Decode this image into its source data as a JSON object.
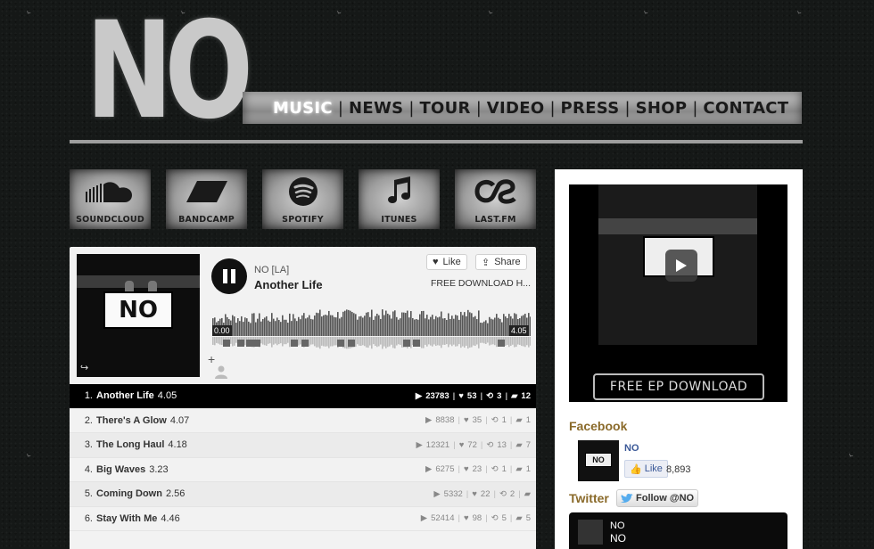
{
  "logo": {
    "text": "NO"
  },
  "nav": {
    "items": [
      {
        "label": "MUSIC",
        "active": true
      },
      {
        "label": "NEWS",
        "active": false
      },
      {
        "label": "TOUR",
        "active": false
      },
      {
        "label": "VIDEO",
        "active": false
      },
      {
        "label": "PRESS",
        "active": false
      },
      {
        "label": "SHOP",
        "active": false
      },
      {
        "label": "CONTACT",
        "active": false
      }
    ],
    "separator": "|"
  },
  "services": [
    {
      "label": "SOUNDCLOUD",
      "icon": "soundcloud-icon"
    },
    {
      "label": "BANDCAMP",
      "icon": "bandcamp-icon"
    },
    {
      "label": "SPOTIFY",
      "icon": "spotify-icon"
    },
    {
      "label": "ITUNES",
      "icon": "music-note-icon"
    },
    {
      "label": "LAST.FM",
      "icon": "lastfm-icon"
    }
  ],
  "player": {
    "artwork_text": "NO",
    "artist": "NO [LA]",
    "track": "Another Life",
    "like_label": "Like",
    "share_label": "Share",
    "download_label": "FREE DOWNLOAD H...",
    "time_current": "0.00",
    "time_total": "4.05",
    "add_label": "+",
    "tracks": [
      {
        "num": "1.",
        "title": "Another Life",
        "duration": "4.05",
        "plays": "23783",
        "likes": "53",
        "reposts": "3",
        "comments": "12",
        "selected": true
      },
      {
        "num": "2.",
        "title": "There's A Glow",
        "duration": "4.07",
        "plays": "8838",
        "likes": "35",
        "reposts": "1",
        "comments": "1",
        "selected": false
      },
      {
        "num": "3.",
        "title": "The Long Haul",
        "duration": "4.18",
        "plays": "12321",
        "likes": "72",
        "reposts": "13",
        "comments": "7",
        "selected": false
      },
      {
        "num": "4.",
        "title": "Big Waves",
        "duration": "3.23",
        "plays": "6275",
        "likes": "23",
        "reposts": "1",
        "comments": "1",
        "selected": false
      },
      {
        "num": "5.",
        "title": "Coming Down",
        "duration": "2.56",
        "plays": "5332",
        "likes": "22",
        "reposts": "2",
        "comments": null,
        "selected": false
      },
      {
        "num": "6.",
        "title": "Stay With Me",
        "duration": "4.46",
        "plays": "52414",
        "likes": "98",
        "reposts": "5",
        "comments": "5",
        "selected": false
      }
    ]
  },
  "sidebar": {
    "video_banner_text": "NO",
    "ep_label": "FREE EP DOWNLOAD",
    "facebook": {
      "heading": "Facebook",
      "thumb_text": "NO",
      "name": "NO",
      "like_label": "Like",
      "count": "8,893"
    },
    "twitter": {
      "heading": "Twitter",
      "follow_label": "Follow @NO",
      "name1": "NO",
      "name2": "NO"
    }
  },
  "colors": {
    "background": "#151817",
    "heading_gold": "#8a6a2a",
    "facebook_blue": "#3b5998"
  }
}
